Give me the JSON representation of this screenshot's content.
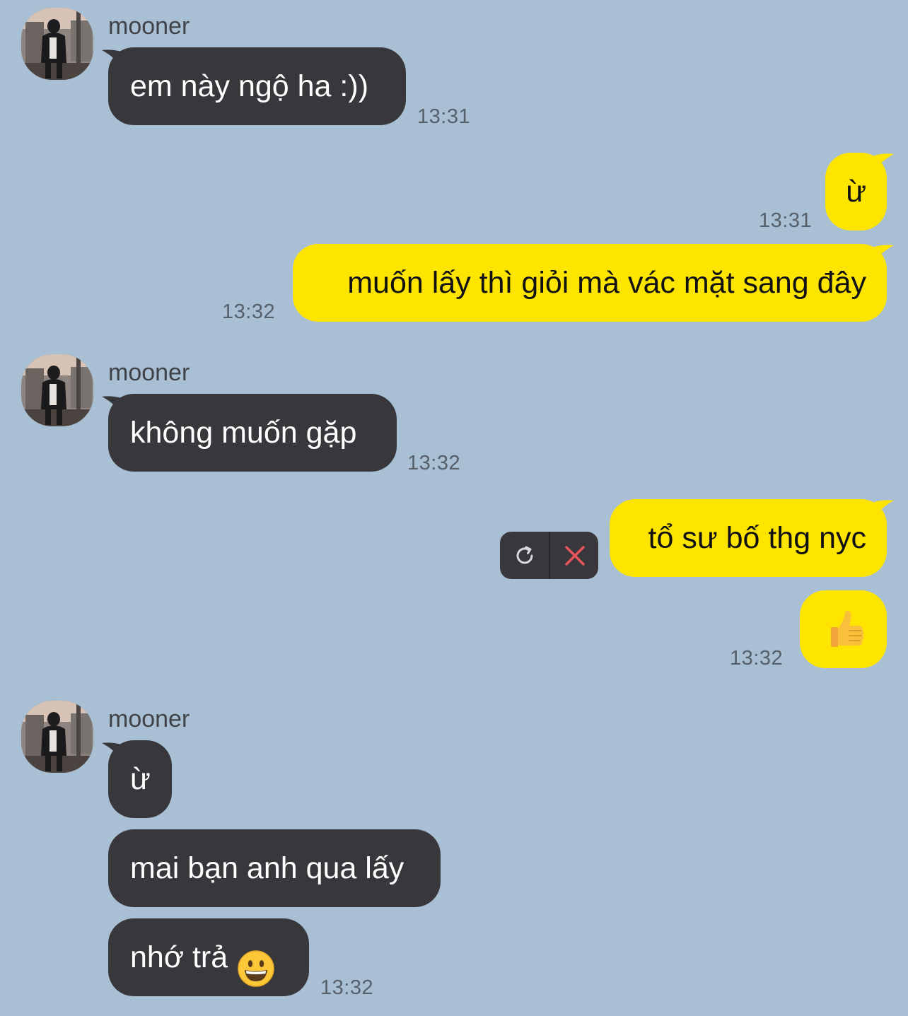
{
  "chat": {
    "messages": [
      {
        "sender": "mooner",
        "text": "em này ngộ ha :))",
        "time": "13:31"
      },
      {
        "text": "ừ",
        "time": "13:31"
      },
      {
        "text": "muốn lấy thì giỏi mà vác mặt sang đây",
        "time": "13:32"
      },
      {
        "sender": "mooner",
        "text": "không muốn gặp",
        "time": "13:32"
      },
      {
        "text": "tổ sư bố thg nyc",
        "status": "failed"
      },
      {
        "text": "👍",
        "time": "13:32"
      },
      {
        "sender": "mooner",
        "text": "ừ"
      },
      {
        "text": "mai bạn anh qua lấy"
      },
      {
        "text": "nhớ trả",
        "emoji": "grinning-face",
        "time": "13:32"
      }
    ]
  },
  "icons": {
    "retry": "retry-icon",
    "delete": "close-icon",
    "thumbs_up": "thumbs-up-emoji",
    "grin": "grinning-face-emoji"
  },
  "colors": {
    "background": "#a9bfd3",
    "incoming_bubble": "#38383c",
    "outgoing_bubble": "#fee500",
    "delete_x": "#e8545a"
  }
}
